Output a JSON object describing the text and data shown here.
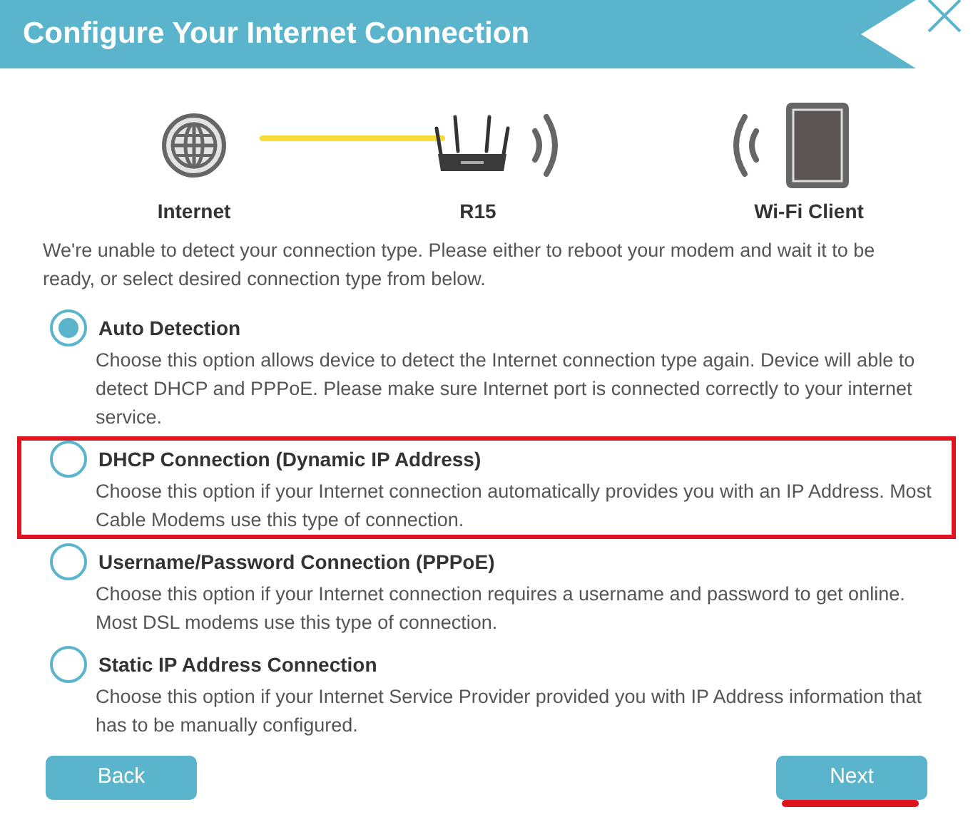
{
  "header": {
    "title": "Configure Your Internet Connection"
  },
  "diagram": [
    {
      "kind": "globe",
      "label": "Internet"
    },
    {
      "kind": "router",
      "label": "R15"
    },
    {
      "kind": "tablet",
      "label": "Wi-Fi Client"
    }
  ],
  "intro": "We're unable to detect your connection type. Please either to reboot your modem and wait it to be ready, or select desired connection type from below.",
  "options": [
    {
      "title": "Auto Detection",
      "description": "Choose this option allows device to detect the Internet connection type again. Device will able to detect DHCP and PPPoE. Please make sure Internet port is connected correctly to your internet service.",
      "selected": true,
      "highlighted": false
    },
    {
      "title": "DHCP Connection (Dynamic IP Address)",
      "description": "Choose this option if your Internet connection automatically provides you with an IP Address. Most Cable Modems use this type of connection.",
      "selected": false,
      "highlighted": true
    },
    {
      "title": "Username/Password Connection (PPPoE)",
      "description": "Choose this option if your Internet connection requires a username and password to get online. Most DSL modems use this type of connection.",
      "selected": false,
      "highlighted": false
    },
    {
      "title": "Static IP Address Connection",
      "description": "Choose this option if your Internet Service Provider provided you with IP Address information that has to be manually configured.",
      "selected": false,
      "highlighted": false
    }
  ],
  "buttons": [
    {
      "label": "Back",
      "underlined": false
    },
    {
      "label": "Next",
      "underlined": true
    }
  ]
}
